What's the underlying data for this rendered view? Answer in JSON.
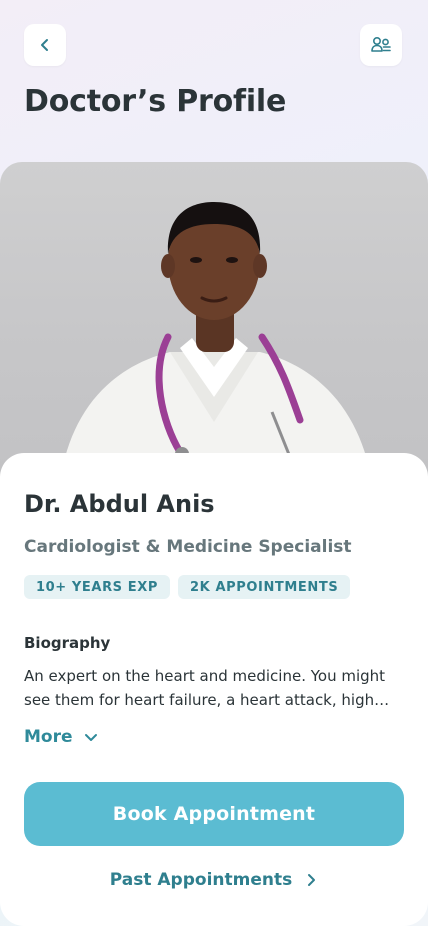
{
  "header": {
    "title": "Doctor’s Profile",
    "back_icon": "chevron-left-icon",
    "switch_icon": "users-switch-icon"
  },
  "doctor": {
    "name": "Dr. Abdul Anis",
    "specialty": "Cardiologist & Medicine Specialist",
    "chips": [
      "10+ YEARS EXP",
      "2K APPOINTMENTS"
    ],
    "photo": "doctor-portrait"
  },
  "biography": {
    "heading": "Biography",
    "text": "An expert on the heart and medicine. You might see them for heart failure, a heart attack, high…",
    "more_label": "More"
  },
  "actions": {
    "book_label": "Book Appointment",
    "past_label": "Past Appointments"
  },
  "colors": {
    "accent": "#5bbcd2",
    "link": "#2f8a9a",
    "chip_bg": "#e6f2f4",
    "text_dark": "#2b3438"
  }
}
